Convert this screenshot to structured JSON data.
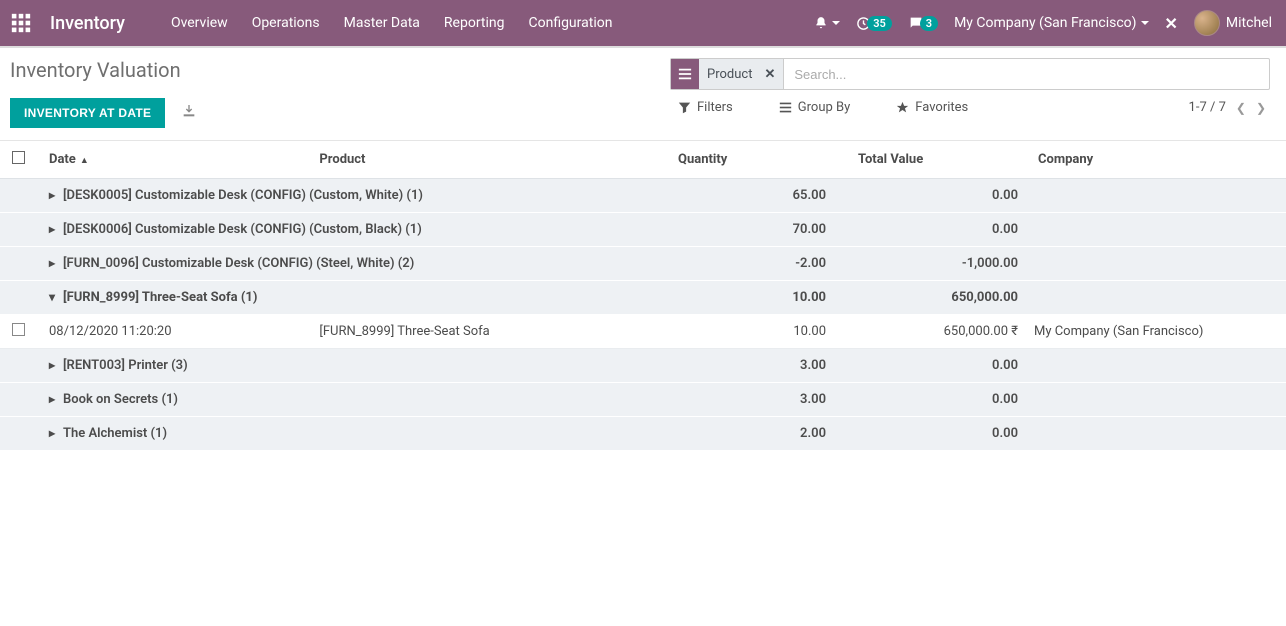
{
  "nav": {
    "brand": "Inventory",
    "links": [
      "Overview",
      "Operations",
      "Master Data",
      "Reporting",
      "Configuration"
    ],
    "clock_badge": "35",
    "chat_badge": "3",
    "company": "My Company (San Francisco)",
    "user": "Mitchel"
  },
  "page": {
    "title": "Inventory Valuation",
    "primary_button": "INVENTORY AT DATE"
  },
  "search": {
    "facet_label": "Product",
    "placeholder": "Search..."
  },
  "controls": {
    "filters": "Filters",
    "groupby": "Group By",
    "favorites": "Favorites",
    "pager": "1-7 / 7"
  },
  "columns": {
    "date": "Date",
    "product": "Product",
    "quantity": "Quantity",
    "total_value": "Total Value",
    "company": "Company"
  },
  "groups": [
    {
      "label": "[DESK0005] Customizable Desk (CONFIG) (Custom, White) (1)",
      "qty": "65.00",
      "tv": "0.00",
      "expanded": false
    },
    {
      "label": "[DESK0006] Customizable Desk (CONFIG) (Custom, Black) (1)",
      "qty": "70.00",
      "tv": "0.00",
      "expanded": false
    },
    {
      "label": "[FURN_0096] Customizable Desk (CONFIG) (Steel, White) (2)",
      "qty": "-2.00",
      "tv": "-1,000.00",
      "expanded": false
    },
    {
      "label": "[FURN_8999] Three-Seat Sofa (1)",
      "qty": "10.00",
      "tv": "650,000.00",
      "expanded": true,
      "rows": [
        {
          "date": "08/12/2020 11:20:20",
          "product": "[FURN_8999] Three-Seat Sofa",
          "qty": "10.00",
          "tv": "650,000.00 ₹",
          "company": "My Company (San Francisco)"
        }
      ]
    },
    {
      "label": "[RENT003] Printer (3)",
      "qty": "3.00",
      "tv": "0.00",
      "expanded": false
    },
    {
      "label": "Book on Secrets (1)",
      "qty": "3.00",
      "tv": "0.00",
      "expanded": false
    },
    {
      "label": "The Alchemist (1)",
      "qty": "2.00",
      "tv": "0.00",
      "expanded": false
    }
  ]
}
